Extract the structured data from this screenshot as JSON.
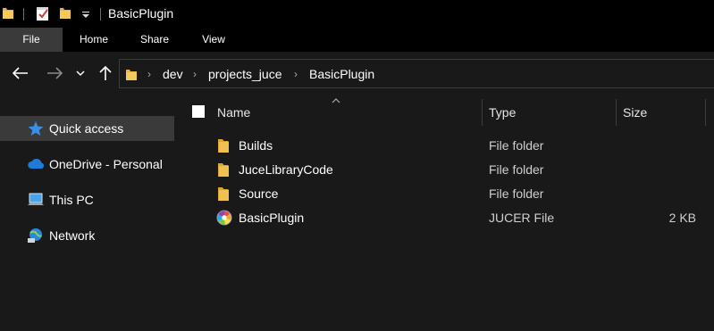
{
  "window": {
    "title": "BasicPlugin"
  },
  "ribbon": {
    "tabs": [
      "File",
      "Home",
      "Share",
      "View"
    ]
  },
  "address": {
    "crumbs": [
      "dev",
      "projects_juce",
      "BasicPlugin"
    ]
  },
  "sidebar": {
    "items": [
      {
        "label": "Quick access",
        "icon": "star-icon"
      },
      {
        "label": "OneDrive - Personal",
        "icon": "cloud-icon"
      },
      {
        "label": "This PC",
        "icon": "computer-icon"
      },
      {
        "label": "Network",
        "icon": "network-icon"
      }
    ]
  },
  "columns": {
    "name": "Name",
    "type": "Type",
    "size": "Size"
  },
  "files": [
    {
      "name": "Builds",
      "type": "File folder",
      "size": "",
      "icon": "folder-icon"
    },
    {
      "name": "JuceLibraryCode",
      "type": "File folder",
      "size": "",
      "icon": "folder-icon"
    },
    {
      "name": "Source",
      "type": "File folder",
      "size": "",
      "icon": "folder-icon"
    },
    {
      "name": "BasicPlugin",
      "type": "JUCER File",
      "size": "2 KB",
      "icon": "jucer-icon"
    }
  ],
  "colors": {
    "background": "#191919",
    "titlebar": "#000000",
    "selected": "#3a3a3a",
    "folder": "#f0c150",
    "star": "#3a8ee6"
  }
}
